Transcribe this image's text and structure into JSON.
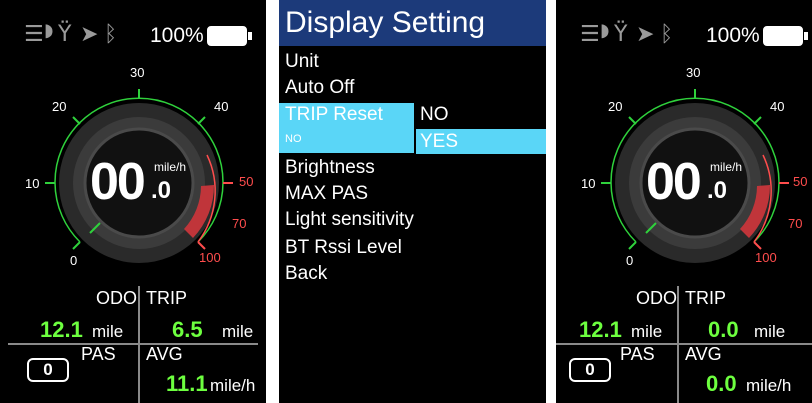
{
  "panels": [
    {
      "status": {
        "icons": [
          "light-icon",
          "wrench-icon",
          "location-arrow-icon",
          "bluetooth-icon"
        ],
        "battery_percent": "100%",
        "battery_level": 100
      },
      "gauge": {
        "ticks": [
          "0",
          "10",
          "20",
          "30",
          "40",
          "50",
          "70",
          "100"
        ],
        "speed_int": "00",
        "speed_dec": ".0",
        "speed_unit": "mile/h"
      },
      "odo": {
        "label": "ODO",
        "value": "12.1",
        "unit": "mile"
      },
      "trip": {
        "label": "TRIP",
        "value": "6.5",
        "unit": "mile"
      },
      "pas": {
        "label": "PAS",
        "value": "0"
      },
      "avg": {
        "label": "AVG",
        "value": "11.1",
        "unit": "mile/h"
      }
    },
    {
      "status": {
        "icons": [
          "light-icon",
          "wrench-icon",
          "location-arrow-icon",
          "bluetooth-icon"
        ],
        "battery_percent": "100%",
        "battery_level": 100
      },
      "gauge": {
        "ticks": [
          "0",
          "10",
          "20",
          "30",
          "40",
          "50",
          "70",
          "100"
        ],
        "speed_int": "00",
        "speed_dec": ".0",
        "speed_unit": "mile/h"
      },
      "odo": {
        "label": "ODO",
        "value": "12.1",
        "unit": "mile"
      },
      "trip": {
        "label": "TRIP",
        "value": "0.0",
        "unit": "mile"
      },
      "pas": {
        "label": "PAS",
        "value": "0"
      },
      "avg": {
        "label": "AVG",
        "value": "0.0",
        "unit": "mile/h"
      }
    }
  ],
  "menu": {
    "title": "Display Setting",
    "items": [
      "Unit",
      "Auto Off",
      "TRIP Reset",
      "NO",
      "Brightness",
      "MAX PAS",
      "Light sensitivity",
      "BT Rssi Level",
      "Back"
    ],
    "options": [
      "NO",
      "YES"
    ],
    "selected_option": "YES"
  },
  "colors": {
    "accent_blue": "#5ad6f7",
    "title_bar": "#1c3a7a",
    "value_green": "#6dff3f",
    "gauge_green": "#2fd13c",
    "gauge_red": "#ff4d4d"
  }
}
